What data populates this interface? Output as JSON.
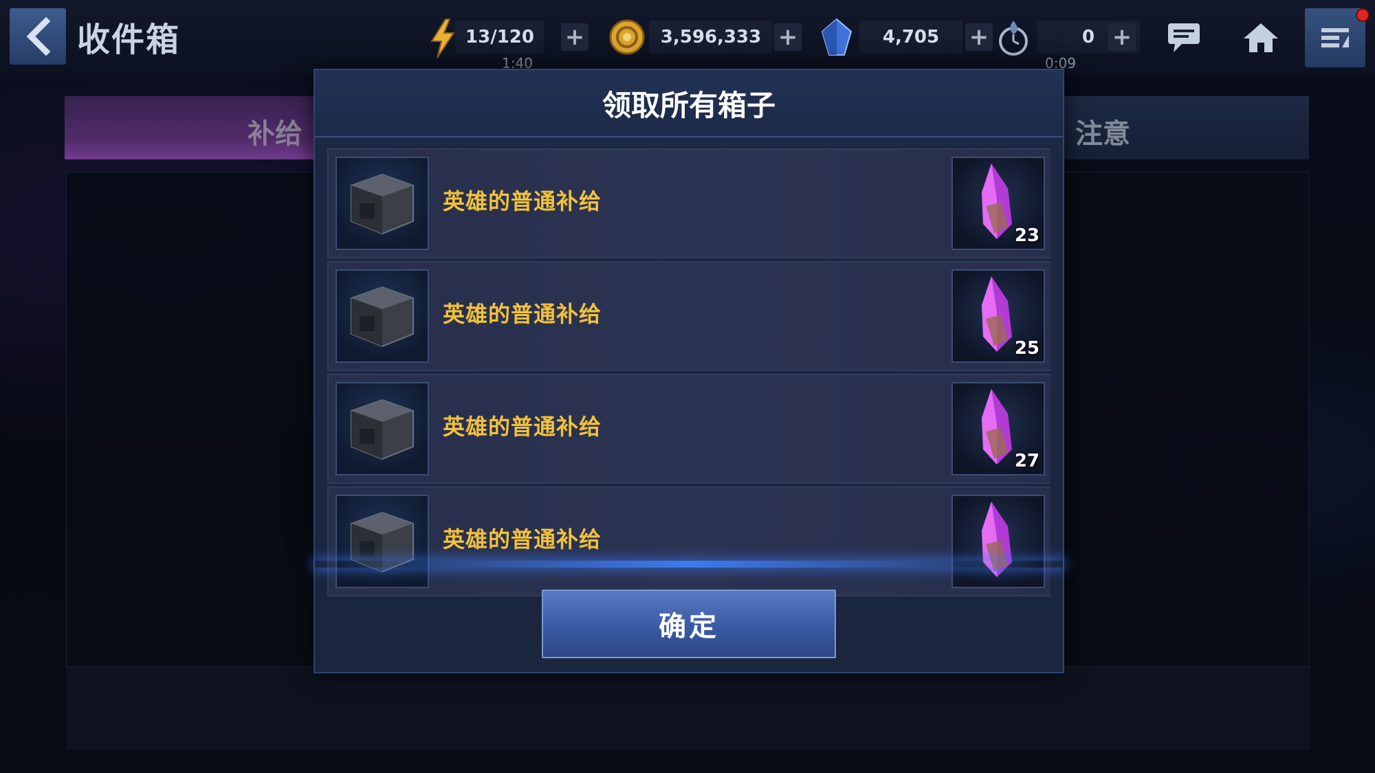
{
  "header": {
    "title": "收件箱",
    "resources": [
      {
        "id": "energy",
        "icon": "lightning-icon",
        "value": "13/120",
        "timer": "1:40"
      },
      {
        "id": "gold",
        "icon": "gold-coin-icon",
        "value": "3,596,333",
        "timer": ""
      },
      {
        "id": "crystal",
        "icon": "blue-crystal-icon",
        "value": "4,705",
        "timer": ""
      },
      {
        "id": "stamina",
        "icon": "timer-flame-icon",
        "value": "0",
        "timer": "0:09"
      }
    ],
    "plus_label": "+"
  },
  "tabs": {
    "left_label": "补给",
    "right_label": "注意"
  },
  "modal": {
    "title": "领取所有箱子",
    "items": [
      {
        "name": "英雄的普通补给",
        "reward_icon": "purple-crystal-shard-icon",
        "count": "23"
      },
      {
        "name": "英雄的普通补给",
        "reward_icon": "purple-crystal-shard-icon",
        "count": "25"
      },
      {
        "name": "英雄的普通补给",
        "reward_icon": "purple-crystal-shard-icon",
        "count": "27"
      },
      {
        "name": "英雄的普通补给",
        "reward_icon": "purple-crystal-shard-icon",
        "count": ""
      }
    ],
    "confirm_label": "确定"
  },
  "colors": {
    "accent_blue": "#3a5aa3",
    "item_name_gold": "#f3c23b",
    "notification_red": "#e02424"
  }
}
